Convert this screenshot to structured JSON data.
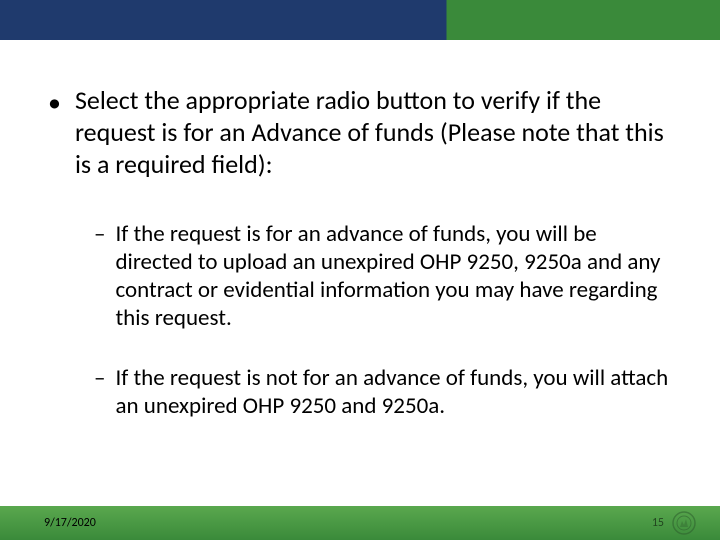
{
  "main_bullet": "Select the appropriate radio button to verify if the request is for an Advance of funds (Please note that this is a required field):",
  "sub_bullets": [
    "If the request is for an advance of funds, you will be directed to upload an unexpired OHP 9250, 9250a and any contract or evidential information you may have regarding this request.",
    "If the request is not for an advance of funds, you will attach an unexpired OHP 9250 and 9250a."
  ],
  "footer": {
    "date": "9/17/2020",
    "page": "15"
  }
}
